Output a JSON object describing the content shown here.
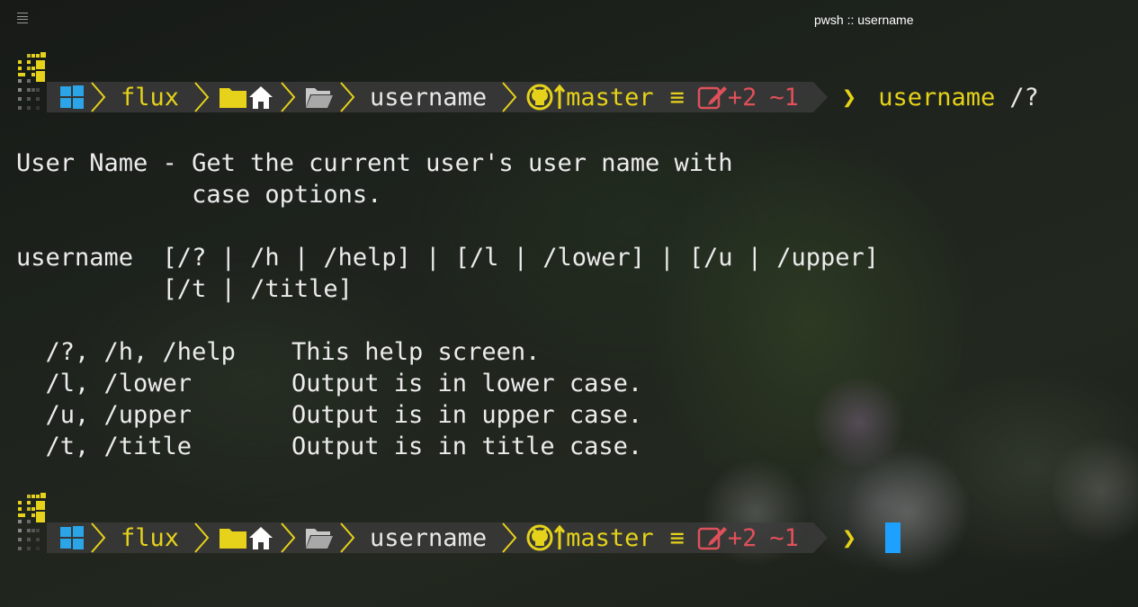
{
  "window": {
    "title": "pwsh :: username"
  },
  "prompt": {
    "user": "flux",
    "directory": "username",
    "branch": "master",
    "branch_sync": "≡",
    "changes_added": "+2",
    "changes_modified": "~1",
    "arrow": "❯",
    "command": "username",
    "argument": "/?"
  },
  "output": {
    "title_line": "User Name - Get the current user's user name with",
    "title_cont": "            case options.",
    "usage_line1": "username  [/? | /h | /help] | [/l | /lower] | [/u | /upper]",
    "usage_line2": "          [/t | /title]",
    "options": [
      {
        "flags": "  /?, /h, /help",
        "desc": "This help screen."
      },
      {
        "flags": "  /l, /lower",
        "desc": "Output is in lower case."
      },
      {
        "flags": "  /u, /upper",
        "desc": "Output is in upper case."
      },
      {
        "flags": "  /t, /title",
        "desc": "Output is in title case."
      }
    ]
  },
  "colors": {
    "accent_yellow": "#e6d21a",
    "error_red": "#e0505a",
    "cursor_blue": "#1ea0ff"
  },
  "icons": [
    "menu-icon",
    "windows-icon",
    "folder-icon",
    "home-icon",
    "open-folder-icon",
    "github-icon",
    "edit-icon"
  ]
}
